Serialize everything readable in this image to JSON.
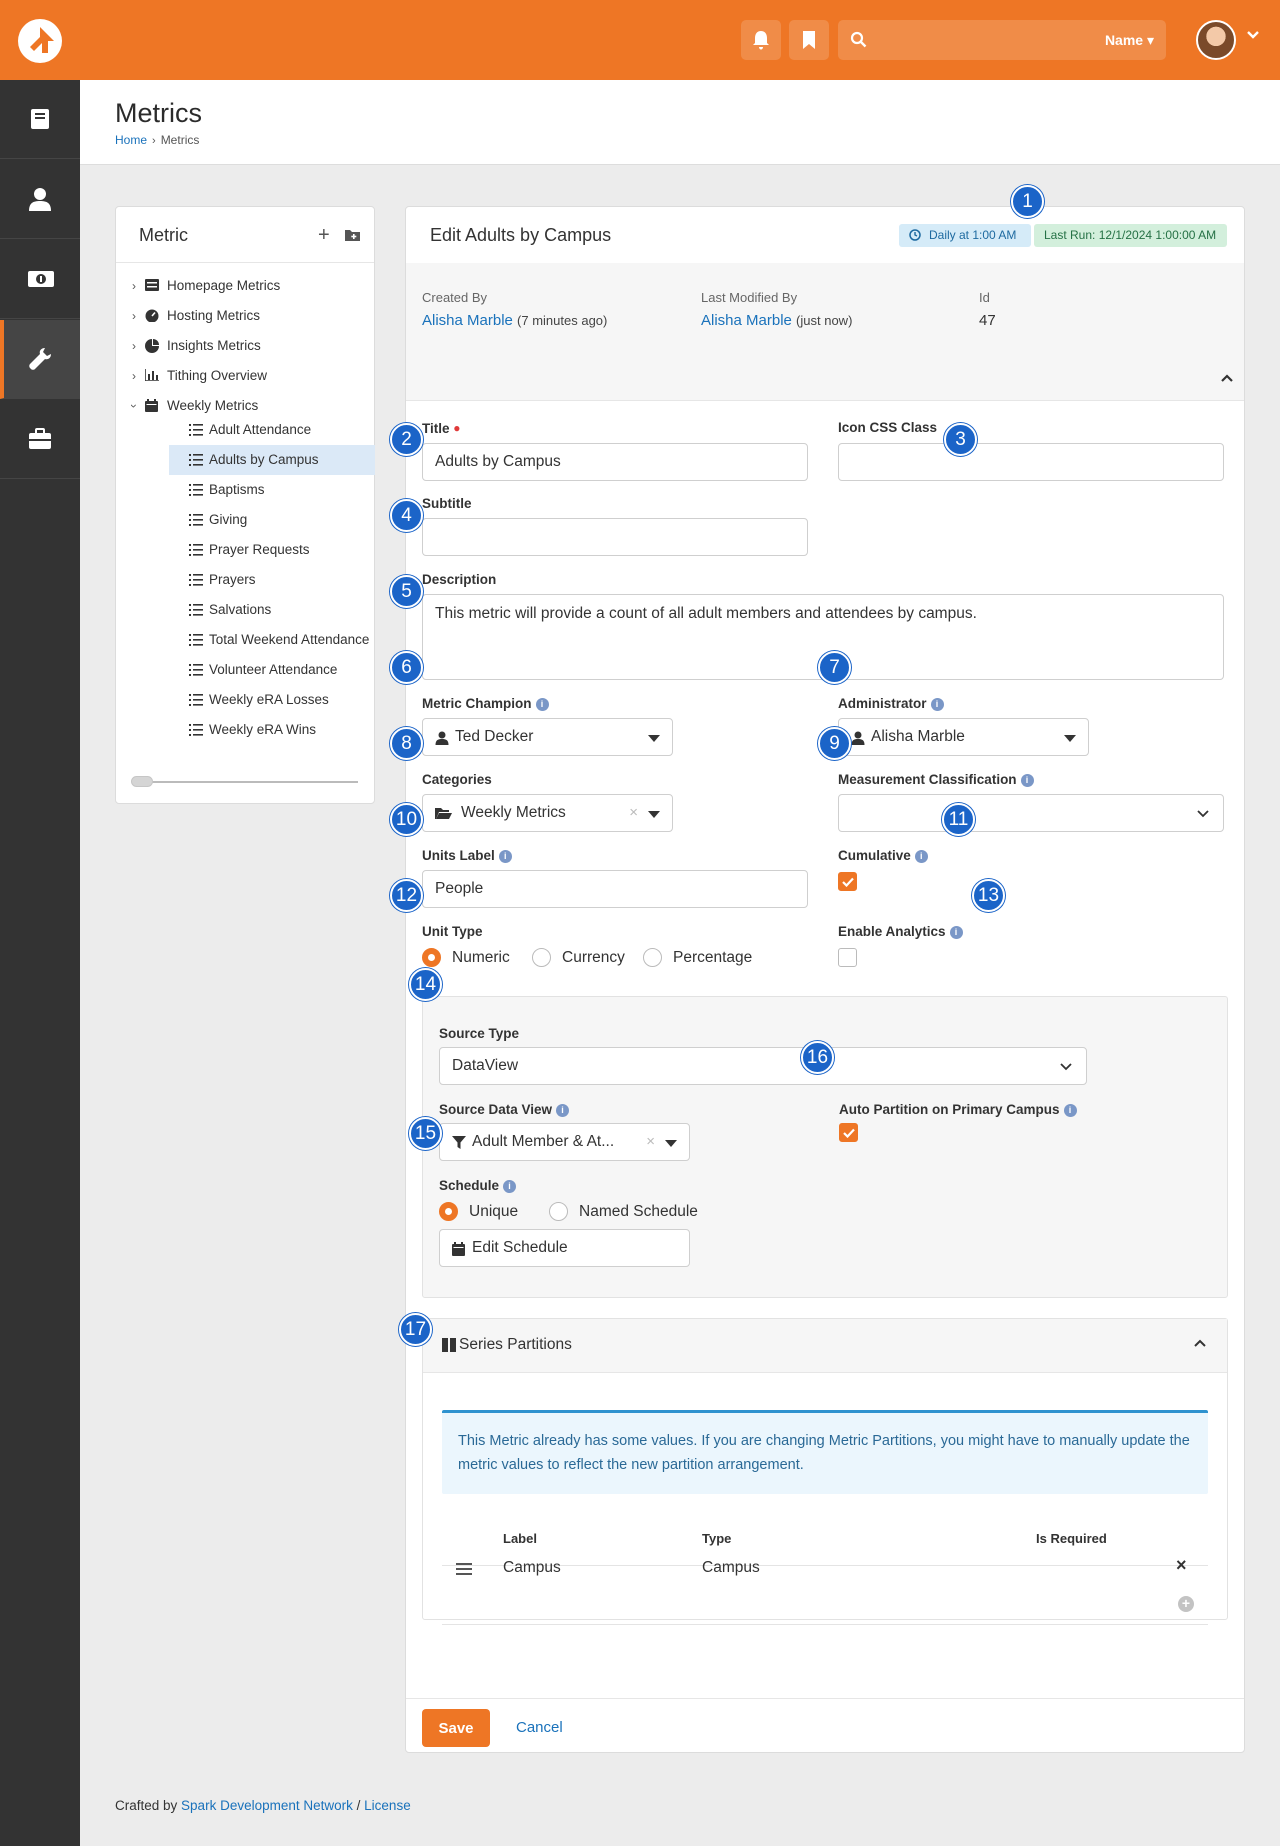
{
  "topbar": {
    "search_type": "Name ▾",
    "search_placeholder": ""
  },
  "header": {
    "title": "Metrics",
    "breadcrumb": [
      "Home",
      "Metrics"
    ]
  },
  "tree": {
    "title": "Metric",
    "categories": [
      {
        "label": "Homepage Metrics",
        "icon": "list-icon"
      },
      {
        "label": "Hosting Metrics",
        "icon": "dashboard-icon"
      },
      {
        "label": "Insights Metrics",
        "icon": "pie-icon"
      },
      {
        "label": "Tithing Overview",
        "icon": "chart-icon"
      },
      {
        "label": "Weekly Metrics",
        "icon": "calendar-icon"
      }
    ],
    "leaves": [
      "Adult Attendance",
      "Adults by Campus",
      "Baptisms",
      "Giving",
      "Prayer Requests",
      "Prayers",
      "Salvations",
      "Total Weekend Attendance",
      "Volunteer Attendance",
      "Weekly eRA Losses",
      "Weekly eRA Wins"
    ],
    "selected_leaf": "Adults by Campus"
  },
  "edit": {
    "title": "Edit Adults by Campus",
    "schedule_badge": "Daily at 1:00 AM",
    "last_run_badge": "Last Run: 12/1/2024 1:00:00 AM",
    "created_by_label": "Created By",
    "created_by_name": "Alisha Marble",
    "created_by_time": "(7 minutes ago)",
    "modified_by_label": "Last Modified By",
    "modified_by_name": "Alisha Marble",
    "modified_by_time": "(just now)",
    "id_label": "Id",
    "id_value": "47",
    "title_label": "Title",
    "title_value": "Adults by Campus",
    "icon_css_label": "Icon CSS Class",
    "icon_css_value": "",
    "subtitle_label": "Subtitle",
    "subtitle_value": "",
    "description_label": "Description",
    "description_value": "This metric will provide a count of all adult members and attendees by campus.",
    "champion_label": "Metric Champion",
    "champion_value": "Ted Decker",
    "admin_label": "Administrator",
    "admin_value": "Alisha Marble",
    "categories_label": "Categories",
    "categories_value": "Weekly Metrics",
    "measurement_label": "Measurement Classification",
    "measurement_value": "",
    "units_label": "Units Label",
    "units_value": "People",
    "cumulative_label": "Cumulative",
    "cumulative_checked": true,
    "unit_type_label": "Unit Type",
    "unit_types": [
      "Numeric",
      "Currency",
      "Percentage"
    ],
    "unit_type_selected": "Numeric",
    "analytics_label": "Enable Analytics",
    "analytics_checked": false,
    "source_type_label": "Source Type",
    "source_type_value": "DataView",
    "data_view_label": "Source Data View",
    "data_view_value": "Adult Member & At...",
    "auto_partition_label": "Auto Partition on Primary Campus",
    "auto_partition_checked": true,
    "schedule_label": "Schedule",
    "schedule_options": [
      "Unique",
      "Named Schedule"
    ],
    "schedule_selected": "Unique",
    "edit_schedule_label": "Edit Schedule",
    "series_title": "Series Partitions",
    "series_alert": "This Metric already has some values. If you are changing Metric Partitions, you might have to manually update the metric values to reflect the new partition arrangement.",
    "table_headers": [
      "Label",
      "Type",
      "Is Required"
    ],
    "table_rows": [
      {
        "label": "Campus",
        "type": "Campus"
      }
    ],
    "save_label": "Save",
    "cancel_label": "Cancel"
  },
  "callouts": [
    "1",
    "2",
    "3",
    "4",
    "5",
    "6",
    "7",
    "8",
    "9",
    "10",
    "11",
    "12",
    "13",
    "14",
    "15",
    "16",
    "17"
  ],
  "footer": {
    "prefix": "Crafted by",
    "link1": "Spark Development Network",
    "sep": "/",
    "link2": "License"
  },
  "colors": {
    "brand_orange": "#ee7625",
    "sidebar_dark": "#333333",
    "callout_blue": "#1b64c8",
    "link_blue": "#1a72bb"
  }
}
